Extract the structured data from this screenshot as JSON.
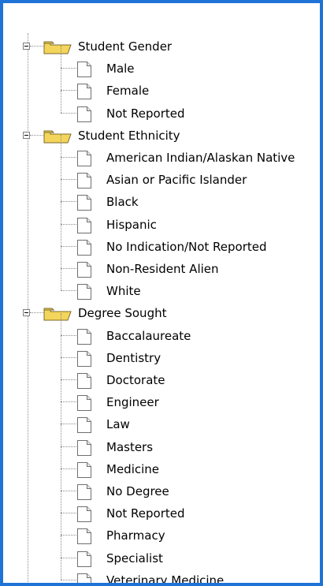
{
  "tree": {
    "groups": [
      {
        "label": "Student Gender",
        "icon": "folder-icon",
        "children": [
          "Male",
          "Female",
          "Not Reported"
        ]
      },
      {
        "label": "Student Ethnicity",
        "icon": "folder-icon",
        "children": [
          "American Indian/Alaskan Native",
          "Asian or Pacific Islander",
          "Black",
          "Hispanic",
          "No Indication/Not Reported",
          "Non-Resident Alien",
          "White"
        ]
      },
      {
        "label": "Degree Sought",
        "icon": "folder-icon",
        "children": [
          "Baccalaureate",
          "Dentistry",
          "Doctorate",
          "Engineer",
          "Law",
          "Masters",
          "Medicine",
          "No Degree",
          "Not Reported",
          "Pharmacy",
          "Specialist",
          "Veterinary Medicine"
        ]
      }
    ]
  },
  "colors": {
    "border": "#1f73d6",
    "folder": "#f4d55b",
    "guide": "#8c8c8c"
  }
}
